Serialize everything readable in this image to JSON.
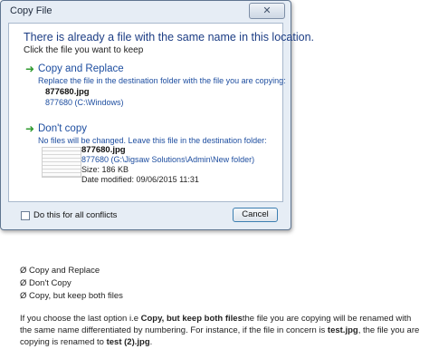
{
  "dialog": {
    "title": "Copy File",
    "close_glyph": "✕",
    "heading": "There is already a file with the same name in this location.",
    "subheading": "Click the file you want to keep",
    "option1": {
      "arrow": "➜",
      "title": "Copy and Replace",
      "description": "Replace the file in the destination folder with the file you are copying:",
      "file_name": "877680.jpg",
      "file_path": "877680 (C:\\Windows)"
    },
    "option2": {
      "arrow": "➜",
      "title": "Don't copy",
      "description": "No files will be changed. Leave this file in the destination folder:",
      "file_name": "877680.jpg",
      "file_path": "877680 (G:\\Jigsaw Solutions\\Admin\\New folder)",
      "size": "Size: 186 KB",
      "date": "Date modified: 09/06/2015 11:31"
    },
    "checkbox_label": "Do this for all conflicts",
    "cancel_label": "Cancel"
  },
  "below": {
    "list": [
      "Ø Copy and Replace",
      "Ø Don't Copy",
      "Ø Copy, but keep both files"
    ],
    "para_line1_a": "If you choose the last option i.e ",
    "para_line1_b": "Copy, but keep both files",
    "para_line1_c": "the file you are copying will be renamed with",
    "para_line2_a": "the same name differentiated by numbering. For instance, if the file in concern is ",
    "para_line2_b": "test.jpg",
    "para_line2_c": ", the file you are",
    "para_line3_a": "copying is renamed to  ",
    "para_line3_b": "test (2).jpg",
    "para_line3_c": "."
  }
}
